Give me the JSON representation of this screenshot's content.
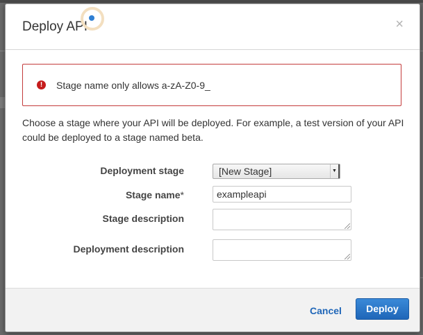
{
  "dialog": {
    "title": "Deploy API",
    "close_glyph": "×",
    "error_message": "Stage name only allows a-zA-Z0-9_",
    "help_text": "Choose a stage where your API will be deployed. For example, a test version of your API could be deployed to a stage named beta."
  },
  "form": {
    "deployment_stage_label": "Deployment stage",
    "deployment_stage_value": "[New Stage]",
    "stage_name_label": "Stage name",
    "stage_name_required": "*",
    "stage_name_value": "exampleapi",
    "stage_description_label": "Stage description",
    "deployment_description_label": "Deployment description"
  },
  "footer": {
    "cancel_label": "Cancel",
    "deploy_label": "Deploy"
  },
  "colors": {
    "primary": "#1f66b8",
    "error": "#c51c1c"
  },
  "icons": {
    "error": "exclamation-circle-icon",
    "close": "close-icon",
    "select_arrow": "caret-down-icon"
  }
}
